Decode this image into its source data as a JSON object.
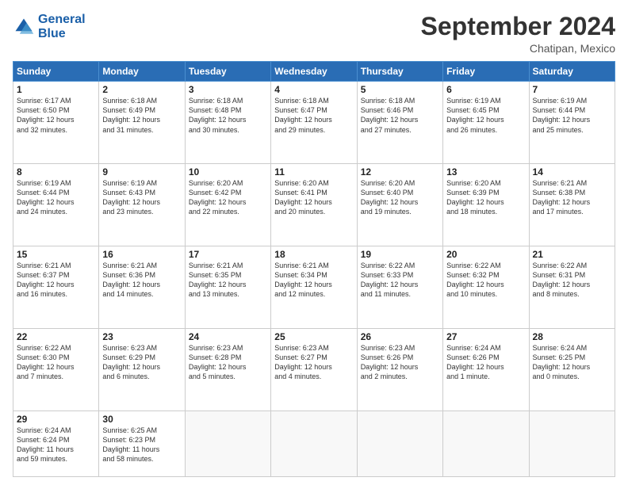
{
  "logo": {
    "line1": "General",
    "line2": "Blue"
  },
  "title": "September 2024",
  "subtitle": "Chatipan, Mexico",
  "days_header": [
    "Sunday",
    "Monday",
    "Tuesday",
    "Wednesday",
    "Thursday",
    "Friday",
    "Saturday"
  ],
  "weeks": [
    [
      {
        "day": "1",
        "info": "Sunrise: 6:17 AM\nSunset: 6:50 PM\nDaylight: 12 hours\nand 32 minutes."
      },
      {
        "day": "2",
        "info": "Sunrise: 6:18 AM\nSunset: 6:49 PM\nDaylight: 12 hours\nand 31 minutes."
      },
      {
        "day": "3",
        "info": "Sunrise: 6:18 AM\nSunset: 6:48 PM\nDaylight: 12 hours\nand 30 minutes."
      },
      {
        "day": "4",
        "info": "Sunrise: 6:18 AM\nSunset: 6:47 PM\nDaylight: 12 hours\nand 29 minutes."
      },
      {
        "day": "5",
        "info": "Sunrise: 6:18 AM\nSunset: 6:46 PM\nDaylight: 12 hours\nand 27 minutes."
      },
      {
        "day": "6",
        "info": "Sunrise: 6:19 AM\nSunset: 6:45 PM\nDaylight: 12 hours\nand 26 minutes."
      },
      {
        "day": "7",
        "info": "Sunrise: 6:19 AM\nSunset: 6:44 PM\nDaylight: 12 hours\nand 25 minutes."
      }
    ],
    [
      {
        "day": "8",
        "info": "Sunrise: 6:19 AM\nSunset: 6:44 PM\nDaylight: 12 hours\nand 24 minutes."
      },
      {
        "day": "9",
        "info": "Sunrise: 6:19 AM\nSunset: 6:43 PM\nDaylight: 12 hours\nand 23 minutes."
      },
      {
        "day": "10",
        "info": "Sunrise: 6:20 AM\nSunset: 6:42 PM\nDaylight: 12 hours\nand 22 minutes."
      },
      {
        "day": "11",
        "info": "Sunrise: 6:20 AM\nSunset: 6:41 PM\nDaylight: 12 hours\nand 20 minutes."
      },
      {
        "day": "12",
        "info": "Sunrise: 6:20 AM\nSunset: 6:40 PM\nDaylight: 12 hours\nand 19 minutes."
      },
      {
        "day": "13",
        "info": "Sunrise: 6:20 AM\nSunset: 6:39 PM\nDaylight: 12 hours\nand 18 minutes."
      },
      {
        "day": "14",
        "info": "Sunrise: 6:21 AM\nSunset: 6:38 PM\nDaylight: 12 hours\nand 17 minutes."
      }
    ],
    [
      {
        "day": "15",
        "info": "Sunrise: 6:21 AM\nSunset: 6:37 PM\nDaylight: 12 hours\nand 16 minutes."
      },
      {
        "day": "16",
        "info": "Sunrise: 6:21 AM\nSunset: 6:36 PM\nDaylight: 12 hours\nand 14 minutes."
      },
      {
        "day": "17",
        "info": "Sunrise: 6:21 AM\nSunset: 6:35 PM\nDaylight: 12 hours\nand 13 minutes."
      },
      {
        "day": "18",
        "info": "Sunrise: 6:21 AM\nSunset: 6:34 PM\nDaylight: 12 hours\nand 12 minutes."
      },
      {
        "day": "19",
        "info": "Sunrise: 6:22 AM\nSunset: 6:33 PM\nDaylight: 12 hours\nand 11 minutes."
      },
      {
        "day": "20",
        "info": "Sunrise: 6:22 AM\nSunset: 6:32 PM\nDaylight: 12 hours\nand 10 minutes."
      },
      {
        "day": "21",
        "info": "Sunrise: 6:22 AM\nSunset: 6:31 PM\nDaylight: 12 hours\nand 8 minutes."
      }
    ],
    [
      {
        "day": "22",
        "info": "Sunrise: 6:22 AM\nSunset: 6:30 PM\nDaylight: 12 hours\nand 7 minutes."
      },
      {
        "day": "23",
        "info": "Sunrise: 6:23 AM\nSunset: 6:29 PM\nDaylight: 12 hours\nand 6 minutes."
      },
      {
        "day": "24",
        "info": "Sunrise: 6:23 AM\nSunset: 6:28 PM\nDaylight: 12 hours\nand 5 minutes."
      },
      {
        "day": "25",
        "info": "Sunrise: 6:23 AM\nSunset: 6:27 PM\nDaylight: 12 hours\nand 4 minutes."
      },
      {
        "day": "26",
        "info": "Sunrise: 6:23 AM\nSunset: 6:26 PM\nDaylight: 12 hours\nand 2 minutes."
      },
      {
        "day": "27",
        "info": "Sunrise: 6:24 AM\nSunset: 6:26 PM\nDaylight: 12 hours\nand 1 minute."
      },
      {
        "day": "28",
        "info": "Sunrise: 6:24 AM\nSunset: 6:25 PM\nDaylight: 12 hours\nand 0 minutes."
      }
    ],
    [
      {
        "day": "29",
        "info": "Sunrise: 6:24 AM\nSunset: 6:24 PM\nDaylight: 11 hours\nand 59 minutes."
      },
      {
        "day": "30",
        "info": "Sunrise: 6:25 AM\nSunset: 6:23 PM\nDaylight: 11 hours\nand 58 minutes."
      },
      {
        "day": "",
        "info": ""
      },
      {
        "day": "",
        "info": ""
      },
      {
        "day": "",
        "info": ""
      },
      {
        "day": "",
        "info": ""
      },
      {
        "day": "",
        "info": ""
      }
    ]
  ]
}
